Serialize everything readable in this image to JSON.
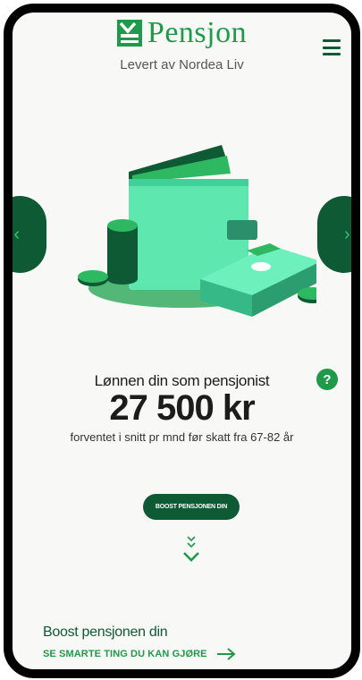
{
  "header": {
    "logo_text": "Pensjon",
    "subtitle": "Levert av Nordea Liv"
  },
  "icons": {
    "menu": "hamburger-icon",
    "prev": "chevron-left-icon",
    "next": "chevron-right-icon",
    "help": "question-icon",
    "scroll": "chevron-down-icon",
    "link_arrow": "arrow-right-icon",
    "illustration": "wallet-illustration"
  },
  "carousel": {
    "prev_glyph": "‹",
    "next_glyph": "›"
  },
  "salary": {
    "label": "Lønnen din som pensjonist",
    "amount": "27 500 kr",
    "description": "forventet i snitt pr mnd før skatt fra 67-82 år",
    "help_glyph": "?"
  },
  "boost": {
    "button_label": "BOOST PENSJONEN DIN",
    "heading": "Boost pensjonen din",
    "link_label": "SE SMARTE TING DU KAN GJØRE"
  },
  "colors": {
    "brand_green": "#1f9a4a",
    "dark_green": "#0e5a35",
    "mint": "#5ee8b0",
    "background": "#f8f8f6"
  }
}
